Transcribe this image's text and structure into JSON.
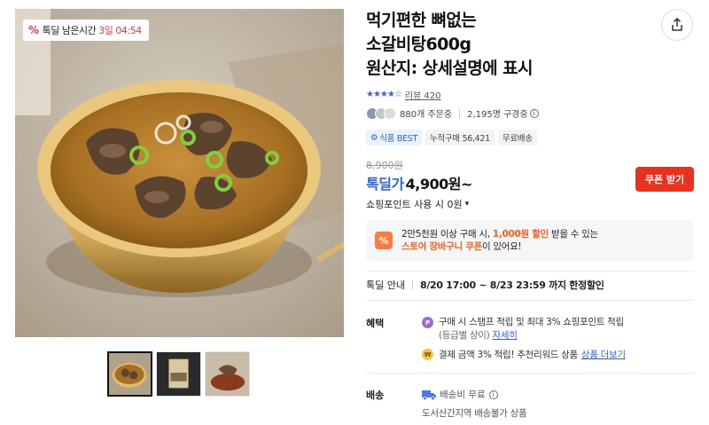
{
  "deal_badge": {
    "label": "톡딜 남은시간",
    "days": "3일",
    "time": "04:54",
    "icon": "percent-icon"
  },
  "title": {
    "line1": "먹기편한 뼈없는",
    "line2": "소갈비탕600g",
    "line3": "원산지: 상세설명에 표시"
  },
  "rating": {
    "stars": 4.5,
    "review_label": "리뷰 420"
  },
  "stats": {
    "orders": "880개 주문중",
    "subscribers": "2,195명 구경중"
  },
  "tags": [
    "식품 BEST",
    "누적구매 56,421",
    "무료배송"
  ],
  "price": {
    "original": "8,900원",
    "sale_label": "톡딜가",
    "sale": "4,900원~"
  },
  "coupon_button": "쿠폰 받기",
  "points": "쇼핑포인트 사용 시 0원",
  "promo": {
    "line1_a": "2만5천원 이상 구매 시, ",
    "line1_b": "1,000원 할인",
    "line1_c": " 받을 수 있는",
    "line2_a": "스토어 장바구니 쿠폰",
    "line2_b": "이 있어요!"
  },
  "deal_info": {
    "label": "톡딜 안내",
    "value": "8/20 17:00 ~ 8/23 23:59 까지 한정할인"
  },
  "benefits": {
    "label": "혜택",
    "item1_a": "구매 시 스탬프 적립 및 최대 3% 쇼핑포인트 적립",
    "item1_b": "(등급별 상이)",
    "item1_link": "자세히",
    "item2_a": "결제 금액 3% 적립! 추천리워드 상품",
    "item2_link": "상품 더보기"
  },
  "shipping": {
    "label": "배송",
    "fee": "배송비 무료",
    "note": "도서산간지역 배송불가 상품"
  },
  "colors": {
    "accent_blue": "#2c65e6",
    "coupon_red": "#e8321e",
    "promo_orange": "#ff5b1a"
  }
}
